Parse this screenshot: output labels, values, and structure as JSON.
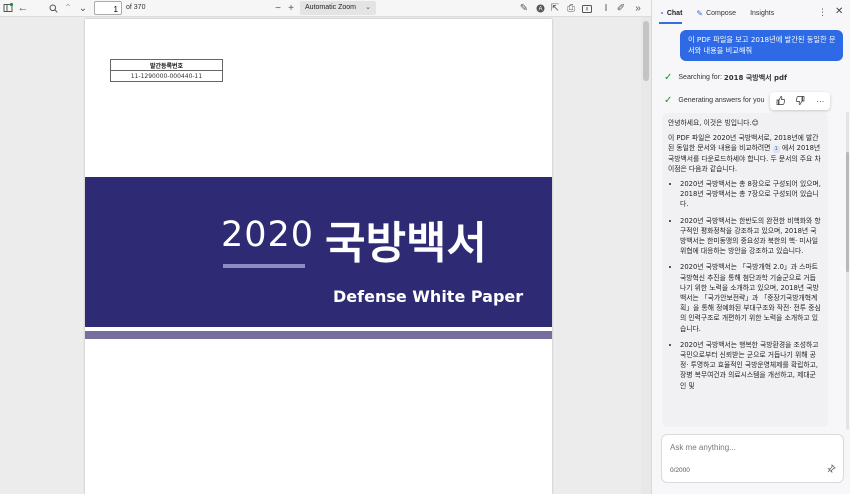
{
  "toolbar": {
    "page_number": "1",
    "page_count": "of 370",
    "zoom_value": "Automatic Zoom"
  },
  "document": {
    "registration_header": "발간등록번호",
    "registration_number": "11-1290000-000440-11",
    "year": "2020",
    "title_ko": "국방백서",
    "title_en": "Defense White Paper"
  },
  "chat": {
    "tabs": [
      "Chat",
      "Compose",
      "Insights"
    ],
    "user_message": "이 PDF 파일을 보고 2018년에 발간된 동일한 문서와 내용을 비교해줘",
    "step1_prefix": "Searching for: ",
    "step1_query": "2018 국방백서 pdf",
    "step2": "Generating answers for you",
    "greeting": "안녕하세요, 이것은 빙입니다.😊",
    "intro_part1": "이 PDF 파일은 2020년 국방백서로, 2018년에 발간된 동일한 문서와 내용을 비교하려면 ",
    "citation": "1",
    "intro_part2": " 에서 2018년 국방백서를 다운로드하세야 합니다. 두 문서의 주요 차이점은 다음과 같습니다.",
    "bullets": [
      "2020년 국방백서는 총 8장으로 구성되어 있으며, 2018년 국방백서는 총 7장으로 구성되어 있습니다.",
      "2020년 국방백서는 한반도의 완전한 비핵화와 항구적인 평화정착을 강조하고 있으며, 2018년 국방백서는 한미동맹의 중요성과 북한의 핵· 미사일 위협에 대응하는 방안을 강조하고 있습니다.",
      "2020년 국방백서는 「국방개혁 2.0」과 스마트 국방혁신 추진을 통해 첨단과학 기술군으로 거듭나기 위한 노력을 소개하고 있으며, 2018년 국방백서는 「국가안보전략」과 「중장기국방개혁계획」을 통해 정예화된 부대구조와 작전· 전투 중심의 인력구조로 개편하기 위한 노력을 소개하고 있습니다.",
      "2020년 국방백서는 행복한 국방환경을 조성하고 국민으로부터 신뢰받는 군으로 거듭나기 위해 공정· 투명하고 효율적인 국방운영체제를 확립하고, 장병 복무여건과 의료시스템을 개선하고, 제대군인 및"
    ],
    "input_placeholder": "Ask me anything...",
    "char_counter": "0/2000"
  }
}
